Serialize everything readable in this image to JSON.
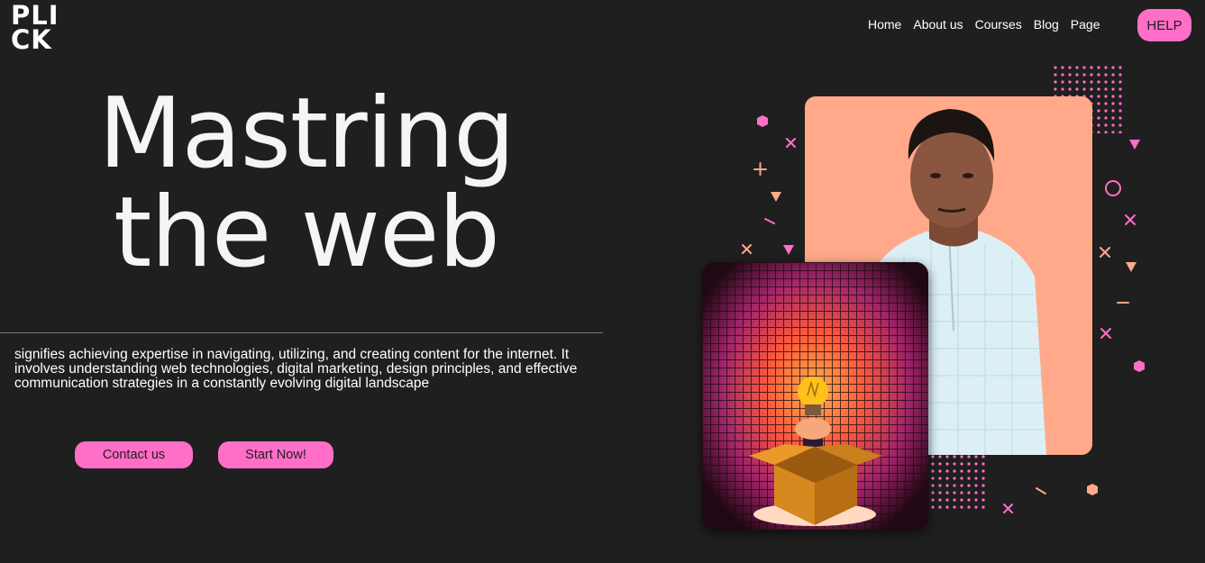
{
  "logo": {
    "line1": "PLI",
    "line2": "CK"
  },
  "nav": {
    "items": [
      "Home",
      "About us",
      "Courses",
      "Blog",
      "Page"
    ],
    "help_label": "HELP"
  },
  "hero": {
    "line1": "Mastring",
    "line2": "the web"
  },
  "description": "signifies achieving expertise in navigating, utilizing, and creating content for the internet. It involves understanding web technologies, digital marketing, design principles, and effective communication strategies in a constantly evolving digital landscape",
  "buttons": {
    "contact": "Contact us",
    "start": "Start Now!"
  },
  "colors": {
    "background": "#1f1f1f",
    "accent_pink": "#ff6ec7",
    "peach": "#ffa98a"
  }
}
